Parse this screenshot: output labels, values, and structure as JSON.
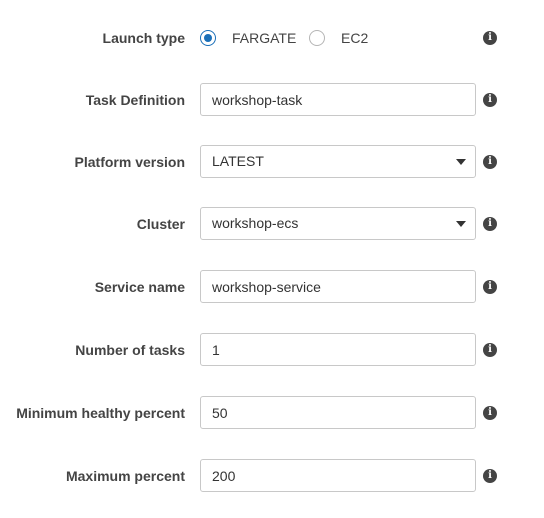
{
  "launch_type": {
    "label": "Launch type",
    "options": [
      {
        "label": "FARGATE",
        "selected": true
      },
      {
        "label": "EC2",
        "selected": false
      }
    ]
  },
  "task_definition": {
    "label": "Task Definition",
    "value": "workshop-task"
  },
  "platform_version": {
    "label": "Platform version",
    "value": "LATEST"
  },
  "cluster": {
    "label": "Cluster",
    "value": "workshop-ecs"
  },
  "service_name": {
    "label": "Service name",
    "value": "workshop-service"
  },
  "number_of_tasks": {
    "label": "Number of tasks",
    "value": "1"
  },
  "minimum_healthy_percent": {
    "label": "Minimum healthy percent",
    "value": "50"
  },
  "maximum_percent": {
    "label": "Maximum percent",
    "value": "200"
  },
  "info_icon": {
    "glyph": "i",
    "icon": "info-icon"
  },
  "colors": {
    "accent": "#1a6fb8",
    "label": "#444444",
    "border": "#c8c8c8"
  }
}
